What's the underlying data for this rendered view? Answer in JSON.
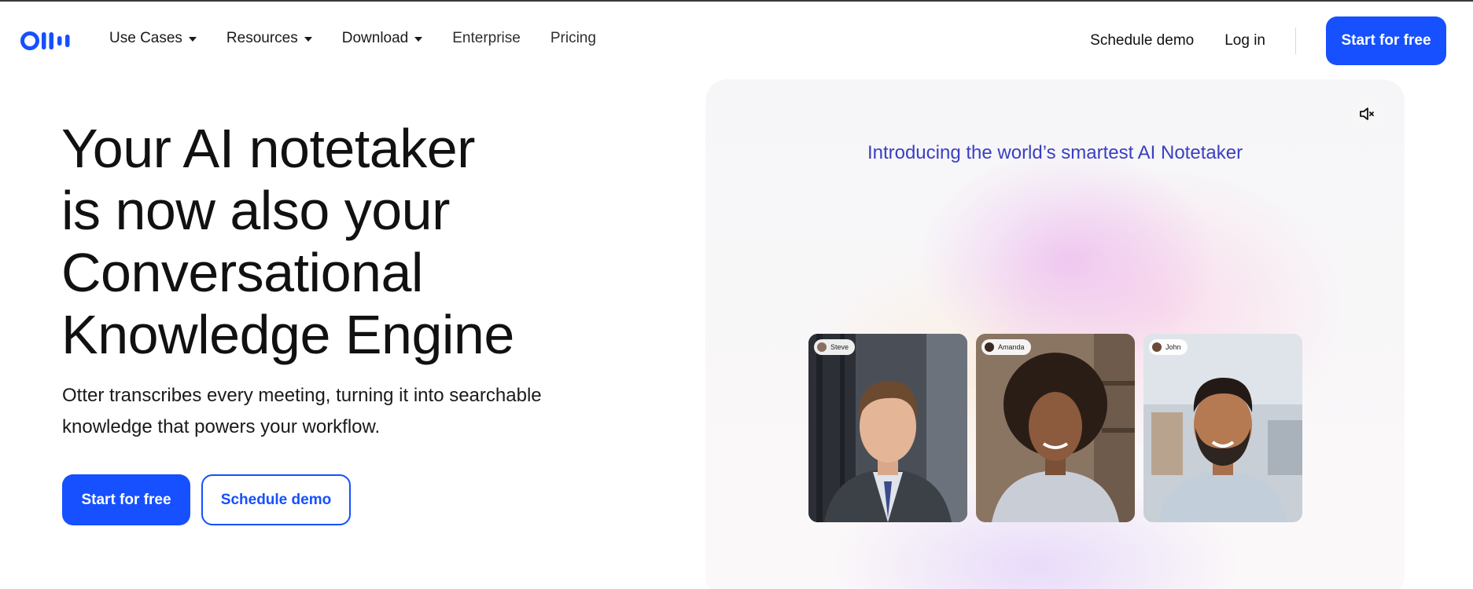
{
  "nav": {
    "logo_icon": "otter-logo-icon",
    "links": [
      {
        "label": "Use Cases",
        "dropdown": true
      },
      {
        "label": "Resources",
        "dropdown": true
      },
      {
        "label": "Download",
        "dropdown": true
      },
      {
        "label": "Enterprise",
        "dropdown": false
      },
      {
        "label": "Pricing",
        "dropdown": false
      }
    ],
    "schedule_demo": "Schedule demo",
    "login": "Log in",
    "cta": "Start for free"
  },
  "hero": {
    "title_lines": [
      "Your AI notetaker",
      "is now also your",
      "Conversational",
      "Knowledge Engine"
    ],
    "subtitle_line1": "Otter transcribes every meeting, turning it into searchable",
    "subtitle_line2": "knowledge that powers your workflow.",
    "primary_cta": "Start for free",
    "secondary_cta": "Schedule demo"
  },
  "video": {
    "mute_icon": "speaker-muted-icon",
    "title": "Introducing the world’s smartest AI Notetaker",
    "participants": [
      {
        "name": "Steve"
      },
      {
        "name": "Amanda"
      },
      {
        "name": "John"
      }
    ]
  },
  "colors": {
    "brand_blue": "#1650ff",
    "video_title": "#3a3fc2"
  }
}
